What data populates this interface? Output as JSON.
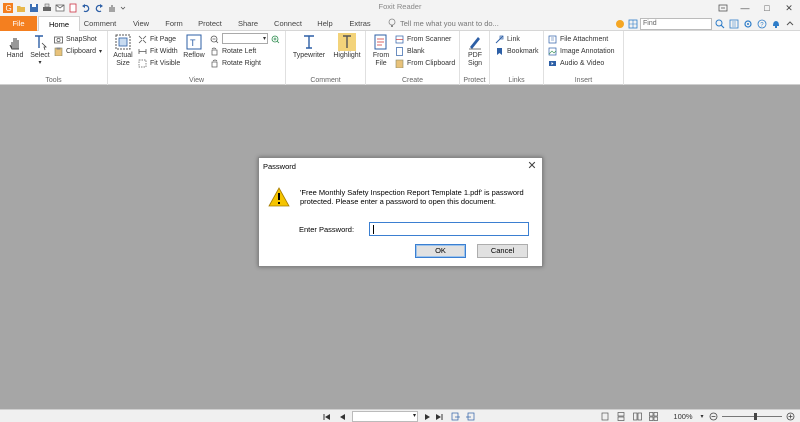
{
  "titlebar": {
    "app_title": "Foxit Reader"
  },
  "tabs": {
    "file": "File",
    "home": "Home",
    "comment": "Comment",
    "view": "View",
    "form": "Form",
    "protect": "Protect",
    "share": "Share",
    "connect": "Connect",
    "help": "Help",
    "extras": "Extras",
    "tell_me_placeholder": "Tell me what you want to do...",
    "find_placeholder": "Find"
  },
  "ribbon": {
    "tools": {
      "label": "Tools",
      "hand": "Hand",
      "select": "Select",
      "snapshot": "SnapShot",
      "clipboard": "Clipboard"
    },
    "view": {
      "label": "View",
      "actual_size_1": "Actual",
      "actual_size_2": "Size",
      "fit_page": "Fit Page",
      "fit_width": "Fit Width",
      "fit_visible": "Fit Visible",
      "reflow": "Reflow",
      "rotate_left": "Rotate Left",
      "rotate_right": "Rotate Right"
    },
    "comment": {
      "label": "Comment",
      "typewriter": "Typewriter",
      "highlight": "Highlight"
    },
    "create": {
      "label": "Create",
      "from_file_1": "From",
      "from_file_2": "File",
      "from_scanner": "From Scanner",
      "blank": "Blank",
      "from_clipboard": "From Clipboard"
    },
    "protect": {
      "label": "Protect",
      "pdf_sign_1": "PDF",
      "pdf_sign_2": "Sign"
    },
    "links": {
      "label": "Links",
      "link": "Link",
      "bookmark": "Bookmark"
    },
    "insert": {
      "label": "Insert",
      "file_attachment": "File Attachment",
      "image_annotation": "Image Annotation",
      "audio_video": "Audio & Video"
    }
  },
  "dialog": {
    "title": "Password",
    "message": "'Free Monthly Safety Inspection Report Template 1.pdf' is password protected. Please enter a password to open this document.",
    "password_label": "Enter Password:",
    "password_value": "",
    "ok_label": "OK",
    "cancel_label": "Cancel"
  },
  "statusbar": {
    "zoom": "100%"
  },
  "colors": {
    "file_tab": "#f47f1f",
    "workspace": "#a6a6a6",
    "accent": "#3b7fd1"
  }
}
